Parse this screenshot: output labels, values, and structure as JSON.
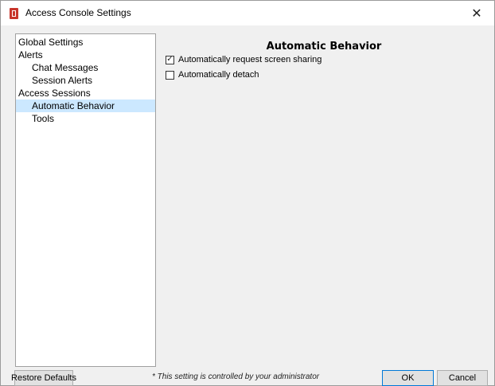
{
  "window": {
    "title": "Access Console Settings",
    "close_glyph": "✕",
    "icon": "app-icon"
  },
  "tree": {
    "items": [
      {
        "label": "Global Settings",
        "level": 0,
        "selected": false
      },
      {
        "label": "Alerts",
        "level": 0,
        "selected": false
      },
      {
        "label": "Chat Messages",
        "level": 1,
        "selected": false
      },
      {
        "label": "Session Alerts",
        "level": 1,
        "selected": false
      },
      {
        "label": "Access Sessions",
        "level": 0,
        "selected": false
      },
      {
        "label": "Automatic Behavior",
        "level": 1,
        "selected": true
      },
      {
        "label": "Tools",
        "level": 1,
        "selected": false
      }
    ]
  },
  "panel": {
    "title": "Automatic Behavior",
    "options": [
      {
        "label": "Automatically request screen sharing",
        "checked": true
      },
      {
        "label": "Automatically detach",
        "checked": false
      }
    ]
  },
  "footer": {
    "restore_label": "Restore Defaults",
    "note": "* This setting is controlled by your administrator",
    "ok_label": "OK",
    "cancel_label": "Cancel"
  },
  "colors": {
    "selection": "#cce8ff",
    "accent": "#0078d7",
    "app_icon": "#c8352b"
  }
}
